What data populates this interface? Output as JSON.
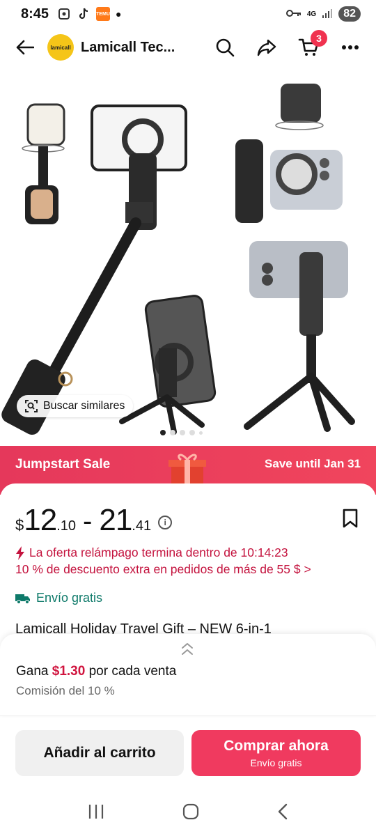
{
  "status_bar": {
    "time": "8:45",
    "temu_label": "TEMU",
    "network": "4G",
    "battery": "82"
  },
  "header": {
    "store_name": "Lamicall Tec...",
    "store_logo_text": "lamicall",
    "cart_count": "3"
  },
  "gallery": {
    "search_similar": "Buscar similares",
    "total_dots": 5,
    "active_dot": 0
  },
  "sale_banner": {
    "title": "Jumpstart Sale",
    "until": "Save until Jan 31"
  },
  "price": {
    "currency": "$",
    "min_whole": "12",
    "min_cents": ".10",
    "separator": "-",
    "max_whole": "21",
    "max_cents": ".41"
  },
  "flash_sale": "La oferta relámpago termina dentro de 10:14:23",
  "discount_offer": "10 % de descuento extra en pedidos de más de 55 $ >",
  "shipping": "Envío gratis",
  "product_title": "Lamicall Holiday Travel Gift – NEW 6-in-1",
  "earnings": {
    "prefix": "Gana",
    "amount": "$1.30",
    "suffix": "por cada venta",
    "commission": "Comisión del 10 %"
  },
  "actions": {
    "add_to_cart": "Añadir al carrito",
    "buy_now": "Comprar ahora",
    "buy_now_sub": "Envío gratis"
  },
  "colors": {
    "accent": "#f03a5f",
    "price_red": "#c4133e",
    "shipping_green": "#0e7a6a",
    "logo_yellow": "#f5c518"
  }
}
